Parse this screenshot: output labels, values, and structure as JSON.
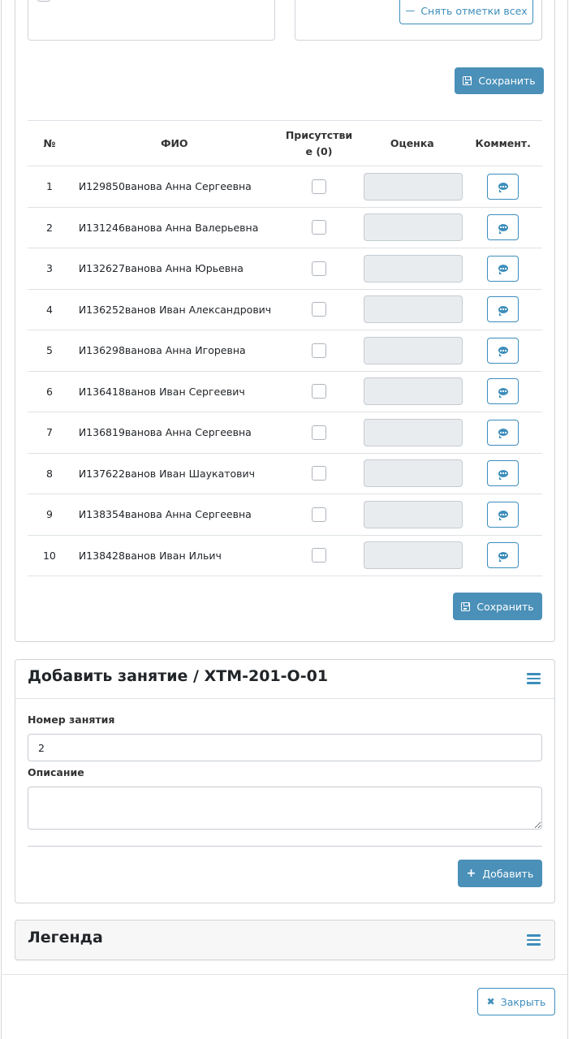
{
  "attendance": {
    "uncheck_all_label": "Снять отметки всех",
    "save_label": "Сохранить",
    "columns": {
      "num": "№",
      "fio": "ФИО",
      "presence": "Присутстви е (0)",
      "grade": "Оценка",
      "comment": "Коммент."
    },
    "rows": [
      {
        "num": "1",
        "fio": "И129850ванова Анна Сергеевна"
      },
      {
        "num": "2",
        "fio": "И131246ванова Анна Валерьевна"
      },
      {
        "num": "3",
        "fio": "И132627ванова Анна Юрьевна"
      },
      {
        "num": "4",
        "fio": "И136252ванов Иван Александрович"
      },
      {
        "num": "5",
        "fio": "И136298ванова Анна Игоревна"
      },
      {
        "num": "6",
        "fio": "И136418ванов Иван Сергеевич"
      },
      {
        "num": "7",
        "fio": "И136819ванова Анна Сергеевна"
      },
      {
        "num": "8",
        "fio": "И137622ванов Иван Шаукатович"
      },
      {
        "num": "9",
        "fio": "И138354ванова Анна Сергеевна"
      },
      {
        "num": "10",
        "fio": "И138428ванов Иван Ильич"
      }
    ]
  },
  "add_lesson": {
    "title": "Добавить занятие / ХТМ-201-О-01",
    "number_label": "Номер занятия",
    "number_value": "2",
    "description_label": "Описание",
    "description_value": "",
    "add_label": "Добавить"
  },
  "legend": {
    "title": "Легенда"
  },
  "footer": {
    "close_label": "Закрыть"
  },
  "colors": {
    "accent": "#3c8dbc",
    "button_solid": "#4a90b8",
    "grade_field_bg": "#e9ecef"
  }
}
